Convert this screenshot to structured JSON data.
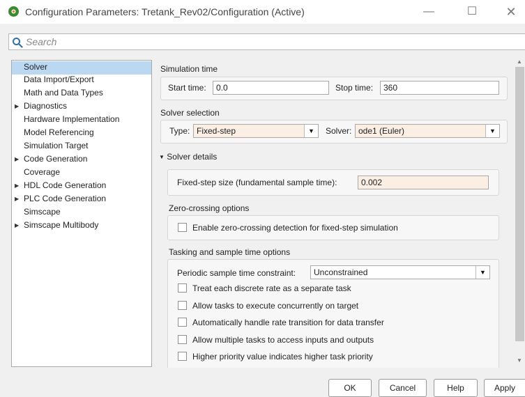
{
  "window": {
    "title": "Configuration Parameters: Tretank_Rev02/Configuration (Active)",
    "controls": {
      "minimize": "—",
      "maximize": "☐",
      "close": "✕"
    }
  },
  "search": {
    "placeholder": "Search",
    "value": ""
  },
  "tree": {
    "items": [
      {
        "label": "Solver",
        "expandable": false,
        "selected": true
      },
      {
        "label": "Data Import/Export",
        "expandable": false
      },
      {
        "label": "Math and Data Types",
        "expandable": false
      },
      {
        "label": "Diagnostics",
        "expandable": true
      },
      {
        "label": "Hardware Implementation",
        "expandable": false
      },
      {
        "label": "Model Referencing",
        "expandable": false
      },
      {
        "label": "Simulation Target",
        "expandable": false
      },
      {
        "label": "Code Generation",
        "expandable": true
      },
      {
        "label": "Coverage",
        "expandable": false
      },
      {
        "label": "HDL Code Generation",
        "expandable": true
      },
      {
        "label": "PLC Code Generation",
        "expandable": true
      },
      {
        "label": "Simscape",
        "expandable": false
      },
      {
        "label": "Simscape Multibody",
        "expandable": true
      }
    ],
    "arrow_glyph": "▶"
  },
  "simulation_time": {
    "title": "Simulation time",
    "start_label": "Start time:",
    "start_value": "0.0",
    "stop_label": "Stop time:",
    "stop_value": "360"
  },
  "solver_selection": {
    "title": "Solver selection",
    "type_label": "Type:",
    "type_value": "Fixed-step",
    "solver_label": "Solver:",
    "solver_value": "ode1 (Euler)"
  },
  "solver_details": {
    "title": "Solver details",
    "toggle_glyph": "▼",
    "step_label": "Fixed-step size (fundamental sample time):",
    "step_value": "0.002"
  },
  "zero_crossing": {
    "title": "Zero-crossing options",
    "enable_label": "Enable zero-crossing detection for fixed-step simulation",
    "enable_checked": false
  },
  "tasking": {
    "title": "Tasking and sample time options",
    "periodic_label": "Periodic sample time constraint:",
    "periodic_value": "Unconstrained",
    "options": [
      {
        "label": "Treat each discrete rate as a separate task",
        "checked": false
      },
      {
        "label": "Allow tasks to execute concurrently on target",
        "checked": false
      },
      {
        "label": "Automatically handle rate transition for data transfer",
        "checked": false
      },
      {
        "label": "Allow multiple tasks to access inputs and outputs",
        "checked": false
      },
      {
        "label": "Higher priority value indicates higher task priority",
        "checked": false
      }
    ]
  },
  "dropdown_glyph": "▼",
  "scroll": {
    "up": "▲",
    "down": "▼"
  },
  "buttons": {
    "ok": "OK",
    "cancel": "Cancel",
    "help": "Help",
    "apply": "Apply"
  },
  "colors": {
    "selection": "#bad8f2",
    "editable_field": "#fbeee3",
    "app_icon": "#3a8a2f"
  }
}
